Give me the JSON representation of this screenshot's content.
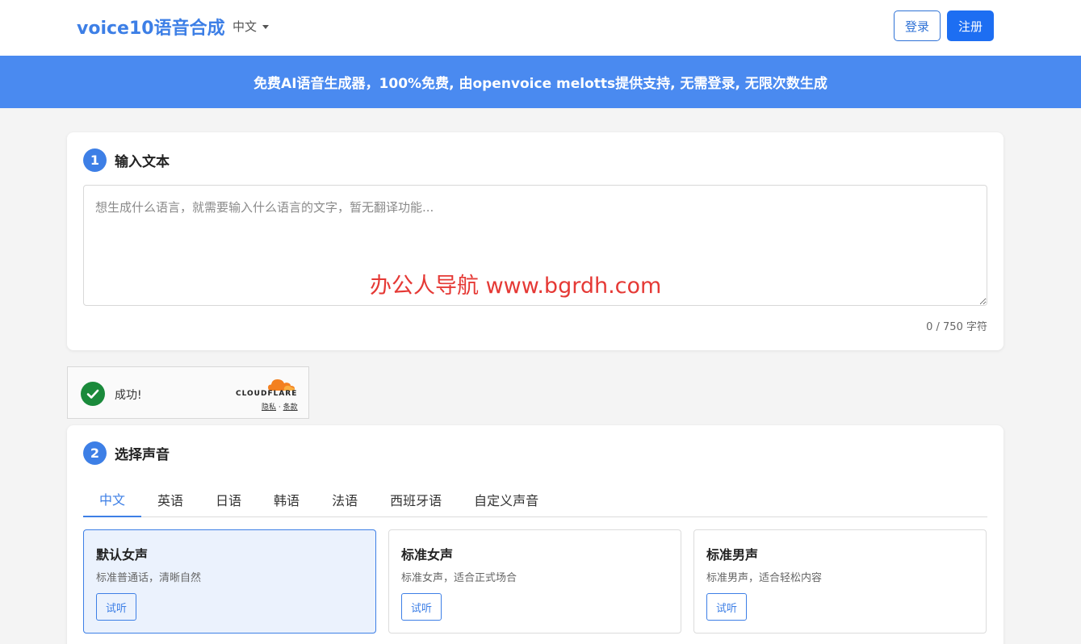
{
  "header": {
    "brand": "voice10语音合成",
    "language": "中文",
    "login_label": "登录",
    "register_label": "注册"
  },
  "banner": {
    "text": "免费AI语音生成器，100%免费, 由openvoice melotts提供支持, 无需登录, 无限次数生成"
  },
  "step1": {
    "number": "1",
    "title": "输入文本",
    "placeholder": "想生成什么语言，就需要输入什么语言的文字，暂无翻译功能...",
    "counter": "0 / 750 字符",
    "watermark": "办公人导航 www.bgrdh.com"
  },
  "captcha": {
    "status": "成功!",
    "brand": "CLOUDFLARE",
    "privacy": "隐私",
    "separator": "·",
    "terms": "条款"
  },
  "step2": {
    "number": "2",
    "title": "选择声音",
    "tabs": [
      "中文",
      "英语",
      "日语",
      "韩语",
      "法语",
      "西班牙语",
      "自定义声音"
    ],
    "active_tab": 0,
    "voices": [
      {
        "title": "默认女声",
        "desc": "标准普通话，清晰自然",
        "button": "试听",
        "selected": true
      },
      {
        "title": "标准女声",
        "desc": "标准女声，适合正式场合",
        "button": "试听",
        "selected": false
      },
      {
        "title": "标准男声",
        "desc": "标准男声，适合轻松内容",
        "button": "试听",
        "selected": false
      }
    ]
  },
  "colors": {
    "accent": "#3d7fe6",
    "banner": "#4a8af0",
    "register": "#1d6ef2",
    "success": "#1a8a3b",
    "watermark": "#e53935"
  }
}
